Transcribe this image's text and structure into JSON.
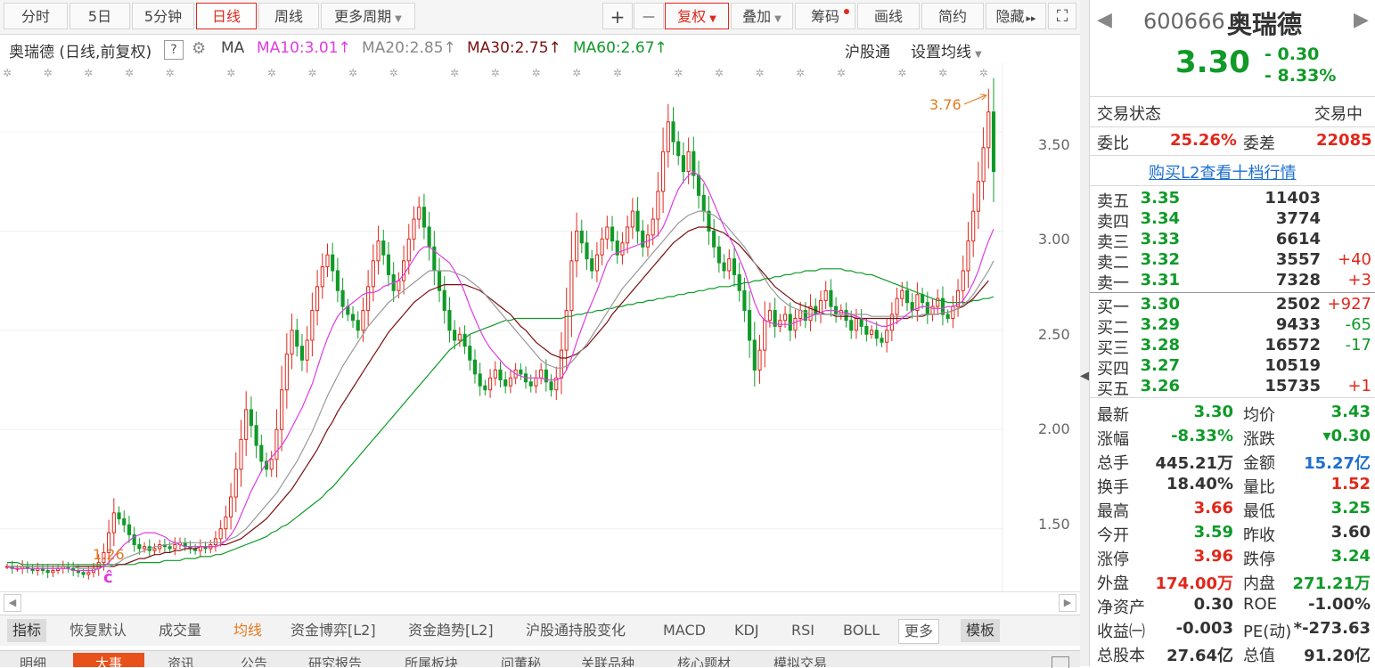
{
  "toolbar": {
    "tabs": [
      "分时",
      "5日",
      "5分钟",
      "日线",
      "周线"
    ],
    "more_period": "更多周期",
    "plus": "+",
    "minus": "—",
    "fuquan": "复权",
    "overlay": "叠加",
    "chips": "筹码",
    "draw": "画线",
    "simple": "简约",
    "hide": "隐藏",
    "hide_arrows": "▸▸",
    "fullscreen_icon": "⛶"
  },
  "ma_row": {
    "stock_label": "奥瑞德 (日线,前复权)",
    "help": "?",
    "ma": "MA",
    "ma10": "MA10:3.01",
    "ma20": "MA20:2.85",
    "ma30": "MA30:2.75",
    "ma60": "MA60:2.67",
    "arrow_up": "↑",
    "hugutong": "沪股通",
    "set_ma": "设置均线"
  },
  "chart_labels": {
    "high_marker": "3.76",
    "low_marker": "1.26",
    "c_marker": "ĉ"
  },
  "colors": {
    "up": "#e0281c",
    "down": "#109a28",
    "ma10": "#e03ce0",
    "ma20": "#999999",
    "ma30": "#7a1010",
    "ma60": "#109a28",
    "marker": "#e07a1c"
  },
  "chart_data": {
    "type": "candlestick",
    "yticks": [
      "3.50",
      "3.00",
      "2.50",
      "2.00",
      "1.50"
    ],
    "ytick_values": [
      3.5,
      3.0,
      2.5,
      2.0,
      1.5
    ],
    "ylim": [
      1.18,
      3.85
    ],
    "high_value": 3.76,
    "low_value": 1.26,
    "close_path": [
      1.31,
      1.3,
      1.3,
      1.31,
      1.3,
      1.29,
      1.3,
      1.29,
      1.28,
      1.29,
      1.3,
      1.31,
      1.3,
      1.29,
      1.28,
      1.27,
      1.28,
      1.3,
      1.33,
      1.38,
      1.48,
      1.58,
      1.55,
      1.52,
      1.47,
      1.42,
      1.4,
      1.41,
      1.39,
      1.4,
      1.42,
      1.41,
      1.4,
      1.42,
      1.43,
      1.41,
      1.4,
      1.39,
      1.41,
      1.4,
      1.42,
      1.45,
      1.5,
      1.56,
      1.66,
      1.8,
      1.95,
      2.1,
      2.02,
      1.92,
      1.84,
      1.8,
      1.85,
      2.0,
      2.2,
      2.38,
      2.5,
      2.42,
      2.35,
      2.45,
      2.6,
      2.72,
      2.82,
      2.88,
      2.8,
      2.7,
      2.62,
      2.58,
      2.55,
      2.5,
      2.6,
      2.72,
      2.85,
      2.95,
      2.88,
      2.78,
      2.7,
      2.75,
      2.85,
      2.96,
      3.06,
      3.12,
      3.02,
      2.92,
      2.8,
      2.7,
      2.6,
      2.5,
      2.45,
      2.48,
      2.42,
      2.35,
      2.28,
      2.22,
      2.2,
      2.26,
      2.3,
      2.25,
      2.22,
      2.26,
      2.3,
      2.28,
      2.24,
      2.22,
      2.26,
      2.3,
      2.24,
      2.2,
      2.26,
      2.4,
      2.6,
      2.85,
      3.0,
      2.94,
      2.86,
      2.8,
      2.88,
      2.96,
      3.02,
      2.95,
      2.88,
      2.94,
      3.02,
      3.1,
      3.0,
      2.92,
      2.98,
      3.06,
      3.2,
      3.4,
      3.55,
      3.45,
      3.38,
      3.3,
      3.4,
      3.28,
      3.18,
      3.1,
      3.0,
      2.92,
      2.84,
      2.8,
      2.86,
      2.78,
      2.7,
      2.6,
      2.45,
      2.3,
      2.4,
      2.55,
      2.6,
      2.52,
      2.55,
      2.58,
      2.5,
      2.56,
      2.6,
      2.55,
      2.62,
      2.58,
      2.65,
      2.7,
      2.62,
      2.58,
      2.6,
      2.55,
      2.5,
      2.56,
      2.52,
      2.48,
      2.5,
      2.46,
      2.44,
      2.5,
      2.58,
      2.66,
      2.7,
      2.64,
      2.6,
      2.68,
      2.64,
      2.58,
      2.62,
      2.66,
      2.58,
      2.56,
      2.62,
      2.7,
      2.8,
      2.95,
      3.1,
      3.25,
      3.42,
      3.6,
      3.3
    ],
    "ma10": [
      1.31,
      1.3,
      1.3,
      1.3,
      1.3,
      1.3,
      1.3,
      1.3,
      1.3,
      1.3,
      1.3,
      1.3,
      1.3,
      1.29,
      1.29,
      1.29,
      1.29,
      1.29,
      1.3,
      1.31,
      1.33,
      1.36,
      1.39,
      1.42,
      1.44,
      1.46,
      1.47,
      1.48,
      1.48,
      1.48,
      1.47,
      1.46,
      1.44,
      1.43,
      1.42,
      1.41,
      1.41,
      1.41,
      1.41,
      1.41,
      1.41,
      1.41,
      1.42,
      1.44,
      1.47,
      1.51,
      1.57,
      1.63,
      1.69,
      1.74,
      1.79,
      1.83,
      1.86,
      1.89,
      1.92,
      1.96,
      2.01,
      2.06,
      2.11,
      2.17,
      2.23,
      2.31,
      2.39,
      2.46,
      2.52,
      2.57,
      2.6,
      2.62,
      2.64,
      2.66,
      2.68,
      2.69,
      2.69,
      2.7,
      2.72,
      2.73,
      2.74,
      2.75,
      2.78,
      2.82,
      2.86,
      2.9,
      2.92,
      2.92,
      2.9,
      2.88,
      2.86,
      2.84,
      2.8,
      2.75,
      2.69,
      2.62,
      2.56,
      2.5,
      2.45,
      2.41,
      2.38,
      2.35,
      2.32,
      2.3,
      2.28,
      2.27,
      2.26,
      2.26,
      2.26,
      2.26,
      2.25,
      2.25,
      2.25,
      2.26,
      2.3,
      2.36,
      2.44,
      2.51,
      2.58,
      2.64,
      2.7,
      2.77,
      2.84,
      2.88,
      2.89,
      2.9,
      2.91,
      2.92,
      2.93,
      2.94,
      2.95,
      2.96,
      2.98,
      3.02,
      3.08,
      3.15,
      3.21,
      3.25,
      3.28,
      3.3,
      3.28,
      3.25,
      3.2,
      3.14,
      3.08,
      3.02,
      2.97,
      2.92,
      2.86,
      2.8,
      2.72,
      2.64,
      2.58,
      2.55,
      2.54,
      2.53,
      2.53,
      2.53,
      2.53,
      2.54,
      2.55,
      2.56,
      2.57,
      2.58,
      2.59,
      2.6,
      2.6,
      2.6,
      2.59,
      2.59,
      2.58,
      2.57,
      2.56,
      2.55,
      2.54,
      2.53,
      2.52,
      2.52,
      2.53,
      2.54,
      2.56,
      2.58,
      2.6,
      2.61,
      2.62,
      2.62,
      2.61,
      2.61,
      2.61,
      2.62,
      2.62,
      2.63,
      2.65,
      2.69,
      2.74,
      2.8,
      2.88,
      2.95,
      3.01
    ],
    "ma20": [
      1.31,
      1.31,
      1.31,
      1.31,
      1.31,
      1.31,
      1.31,
      1.31,
      1.31,
      1.31,
      1.31,
      1.31,
      1.31,
      1.31,
      1.3,
      1.3,
      1.3,
      1.3,
      1.3,
      1.31,
      1.31,
      1.32,
      1.33,
      1.35,
      1.36,
      1.37,
      1.38,
      1.39,
      1.4,
      1.41,
      1.41,
      1.42,
      1.42,
      1.43,
      1.43,
      1.43,
      1.43,
      1.43,
      1.43,
      1.43,
      1.43,
      1.43,
      1.43,
      1.44,
      1.45,
      1.46,
      1.48,
      1.5,
      1.53,
      1.56,
      1.59,
      1.62,
      1.65,
      1.68,
      1.72,
      1.76,
      1.8,
      1.84,
      1.89,
      1.94,
      1.99,
      2.05,
      2.11,
      2.17,
      2.22,
      2.27,
      2.32,
      2.36,
      2.4,
      2.44,
      2.48,
      2.52,
      2.55,
      2.58,
      2.61,
      2.64,
      2.66,
      2.68,
      2.7,
      2.72,
      2.74,
      2.76,
      2.78,
      2.8,
      2.8,
      2.8,
      2.8,
      2.8,
      2.79,
      2.78,
      2.77,
      2.75,
      2.73,
      2.71,
      2.68,
      2.65,
      2.62,
      2.59,
      2.56,
      2.53,
      2.5,
      2.47,
      2.44,
      2.41,
      2.38,
      2.35,
      2.33,
      2.32,
      2.31,
      2.31,
      2.32,
      2.34,
      2.37,
      2.4,
      2.43,
      2.47,
      2.51,
      2.55,
      2.59,
      2.63,
      2.67,
      2.71,
      2.74,
      2.77,
      2.8,
      2.83,
      2.86,
      2.89,
      2.92,
      2.95,
      2.98,
      3.01,
      3.04,
      3.06,
      3.08,
      3.09,
      3.1,
      3.1,
      3.09,
      3.08,
      3.06,
      3.04,
      3.01,
      2.98,
      2.95,
      2.92,
      2.88,
      2.84,
      2.8,
      2.76,
      2.72,
      2.69,
      2.66,
      2.64,
      2.62,
      2.61,
      2.6,
      2.59,
      2.58,
      2.58,
      2.58,
      2.58,
      2.58,
      2.58,
      2.58,
      2.58,
      2.58,
      2.58,
      2.58,
      2.58,
      2.57,
      2.57,
      2.57,
      2.57,
      2.57,
      2.57,
      2.57,
      2.57,
      2.57,
      2.57,
      2.58,
      2.58,
      2.58,
      2.58,
      2.59,
      2.59,
      2.6,
      2.61,
      2.63,
      2.65,
      2.68,
      2.72,
      2.76,
      2.8,
      2.85
    ],
    "ma30": [
      1.31,
      1.31,
      1.31,
      1.31,
      1.31,
      1.31,
      1.31,
      1.31,
      1.31,
      1.31,
      1.31,
      1.31,
      1.31,
      1.31,
      1.31,
      1.31,
      1.31,
      1.31,
      1.31,
      1.31,
      1.31,
      1.31,
      1.32,
      1.32,
      1.33,
      1.34,
      1.35,
      1.35,
      1.36,
      1.37,
      1.37,
      1.38,
      1.38,
      1.39,
      1.39,
      1.4,
      1.4,
      1.4,
      1.41,
      1.41,
      1.41,
      1.41,
      1.42,
      1.42,
      1.43,
      1.44,
      1.45,
      1.47,
      1.49,
      1.51,
      1.53,
      1.55,
      1.58,
      1.61,
      1.64,
      1.67,
      1.7,
      1.74,
      1.78,
      1.82,
      1.86,
      1.9,
      1.95,
      2.0,
      2.04,
      2.09,
      2.13,
      2.17,
      2.21,
      2.25,
      2.29,
      2.33,
      2.37,
      2.41,
      2.45,
      2.49,
      2.52,
      2.55,
      2.58,
      2.61,
      2.64,
      2.66,
      2.68,
      2.7,
      2.71,
      2.72,
      2.73,
      2.73,
      2.73,
      2.73,
      2.73,
      2.72,
      2.71,
      2.7,
      2.68,
      2.66,
      2.64,
      2.62,
      2.6,
      2.58,
      2.55,
      2.52,
      2.5,
      2.47,
      2.44,
      2.42,
      2.4,
      2.38,
      2.37,
      2.36,
      2.36,
      2.37,
      2.38,
      2.4,
      2.42,
      2.45,
      2.48,
      2.51,
      2.54,
      2.58,
      2.61,
      2.64,
      2.67,
      2.7,
      2.73,
      2.76,
      2.79,
      2.82,
      2.85,
      2.88,
      2.91,
      2.94,
      2.96,
      2.98,
      3.0,
      3.01,
      3.02,
      3.02,
      3.02,
      3.01,
      3.0,
      2.99,
      2.97,
      2.95,
      2.93,
      2.9,
      2.87,
      2.84,
      2.81,
      2.78,
      2.75,
      2.72,
      2.7,
      2.68,
      2.66,
      2.64,
      2.63,
      2.62,
      2.61,
      2.6,
      2.59,
      2.58,
      2.58,
      2.57,
      2.57,
      2.57,
      2.57,
      2.56,
      2.56,
      2.56,
      2.56,
      2.56,
      2.56,
      2.56,
      2.56,
      2.56,
      2.56,
      2.56,
      2.57,
      2.57,
      2.57,
      2.58,
      2.58,
      2.58,
      2.59,
      2.59,
      2.6,
      2.61,
      2.62,
      2.64,
      2.66,
      2.69,
      2.72,
      2.75
    ],
    "ma60": [
      1.33,
      1.33,
      1.33,
      1.32,
      1.32,
      1.32,
      1.32,
      1.32,
      1.32,
      1.32,
      1.32,
      1.32,
      1.32,
      1.32,
      1.32,
      1.32,
      1.32,
      1.32,
      1.32,
      1.32,
      1.32,
      1.32,
      1.32,
      1.32,
      1.32,
      1.32,
      1.33,
      1.33,
      1.33,
      1.33,
      1.33,
      1.34,
      1.34,
      1.34,
      1.34,
      1.35,
      1.35,
      1.35,
      1.36,
      1.36,
      1.36,
      1.37,
      1.37,
      1.38,
      1.39,
      1.4,
      1.41,
      1.42,
      1.43,
      1.44,
      1.45,
      1.46,
      1.48,
      1.49,
      1.51,
      1.52,
      1.54,
      1.56,
      1.58,
      1.6,
      1.62,
      1.64,
      1.66,
      1.69,
      1.71,
      1.74,
      1.77,
      1.8,
      1.83,
      1.86,
      1.89,
      1.92,
      1.95,
      1.98,
      2.01,
      2.04,
      2.07,
      2.1,
      2.13,
      2.16,
      2.19,
      2.22,
      2.25,
      2.28,
      2.31,
      2.34,
      2.37,
      2.4,
      2.42,
      2.44,
      2.46,
      2.48,
      2.49,
      2.5,
      2.51,
      2.52,
      2.53,
      2.54,
      2.55,
      2.55,
      2.56,
      2.56,
      2.56,
      2.56,
      2.56,
      2.56,
      2.56,
      2.56,
      2.56,
      2.56,
      2.57,
      2.57,
      2.58,
      2.58,
      2.59,
      2.59,
      2.6,
      2.6,
      2.61,
      2.61,
      2.62,
      2.62,
      2.63,
      2.63,
      2.64,
      2.64,
      2.65,
      2.65,
      2.66,
      2.66,
      2.67,
      2.67,
      2.68,
      2.68,
      2.69,
      2.69,
      2.7,
      2.7,
      2.71,
      2.71,
      2.72,
      2.72,
      2.72,
      2.73,
      2.73,
      2.74,
      2.74,
      2.75,
      2.75,
      2.76,
      2.76,
      2.77,
      2.77,
      2.78,
      2.78,
      2.79,
      2.79,
      2.8,
      2.8,
      2.8,
      2.81,
      2.81,
      2.81,
      2.81,
      2.81,
      2.8,
      2.8,
      2.79,
      2.79,
      2.78,
      2.78,
      2.77,
      2.76,
      2.75,
      2.74,
      2.73,
      2.72,
      2.71,
      2.7,
      2.69,
      2.68,
      2.67,
      2.66,
      2.65,
      2.65,
      2.64,
      2.64,
      2.64,
      2.64,
      2.64,
      2.65,
      2.65,
      2.66,
      2.66,
      2.67
    ]
  },
  "right_panel": {
    "code": "600666",
    "name": "奥瑞德",
    "price": "3.30",
    "change": "- 0.30",
    "change_pct": "- 8.33%",
    "trade_status_label": "交易状态",
    "trade_status": "交易中",
    "weibi_label": "委比",
    "weibi": "25.26%",
    "weicha_label": "委差",
    "weicha": "22085",
    "l2_link": "购买L2查看十档行情",
    "sell": [
      {
        "label": "卖五",
        "price": "3.35",
        "vol": "11403",
        "chg": ""
      },
      {
        "label": "卖四",
        "price": "3.34",
        "vol": "3774",
        "chg": ""
      },
      {
        "label": "卖三",
        "price": "3.33",
        "vol": "6614",
        "chg": ""
      },
      {
        "label": "卖二",
        "price": "3.32",
        "vol": "3557",
        "chg": "+40"
      },
      {
        "label": "卖一",
        "price": "3.31",
        "vol": "7328",
        "chg": "+3"
      }
    ],
    "buy": [
      {
        "label": "买一",
        "price": "3.30",
        "vol": "2502",
        "chg": "+927"
      },
      {
        "label": "买二",
        "price": "3.29",
        "vol": "9433",
        "chg": "-65"
      },
      {
        "label": "买三",
        "price": "3.28",
        "vol": "16572",
        "chg": "-17"
      },
      {
        "label": "买四",
        "price": "3.27",
        "vol": "10519",
        "chg": ""
      },
      {
        "label": "买五",
        "price": "3.26",
        "vol": "15735",
        "chg": "+1"
      }
    ],
    "stats": [
      {
        "l1": "最新",
        "v1": "3.30",
        "c1": "green",
        "l2": "均价",
        "v2": "3.43",
        "c2": "green"
      },
      {
        "l1": "涨幅",
        "v1": "-8.33%",
        "c1": "green",
        "l2": "涨跌",
        "v2": "▾0.30",
        "c2": "green"
      },
      {
        "l1": "总手",
        "v1": "445.21万",
        "c1": "dark",
        "l2": "金额",
        "v2": "15.27亿",
        "c2": "blue"
      },
      {
        "l1": "换手",
        "v1": "18.40%",
        "c1": "dark",
        "l2": "量比",
        "v2": "1.52",
        "c2": "red"
      },
      {
        "l1": "最高",
        "v1": "3.66",
        "c1": "red",
        "l2": "最低",
        "v2": "3.25",
        "c2": "green"
      },
      {
        "l1": "今开",
        "v1": "3.59",
        "c1": "green",
        "l2": "昨收",
        "v2": "3.60",
        "c2": "dark"
      },
      {
        "l1": "涨停",
        "v1": "3.96",
        "c1": "red",
        "l2": "跌停",
        "v2": "3.24",
        "c2": "green"
      },
      {
        "l1": "外盘",
        "v1": "174.00万",
        "c1": "red",
        "l2": "内盘",
        "v2": "271.21万",
        "c2": "green"
      },
      {
        "l1": "净资产",
        "v1": "0.30",
        "c1": "dark",
        "l2": "ROE",
        "v2": "-1.00%",
        "c2": "dark"
      },
      {
        "l1": "收益㈠",
        "v1": "-0.003",
        "c1": "dark",
        "l2": "PE(动)",
        "v2": "*-273.63",
        "c2": "dark"
      },
      {
        "l1": "总股本",
        "v1": "27.64亿",
        "c1": "dark",
        "l2": "总值",
        "v2": "91.20亿",
        "c2": "dark"
      }
    ]
  },
  "bottom_tabs": [
    "指标",
    "恢复默认",
    "成交量",
    "均线",
    "资金博弈[L2]",
    "资金趋势[L2]",
    "沪股通持股变化",
    "MACD",
    "KDJ",
    "RSI",
    "BOLL",
    "更多",
    "模板"
  ],
  "bottom_tabs2": [
    "明细",
    "大事",
    "资讯",
    "公告",
    "研究报告",
    "所属板块",
    "问董秘",
    "关联品种",
    "核心题材",
    "模拟交易"
  ]
}
